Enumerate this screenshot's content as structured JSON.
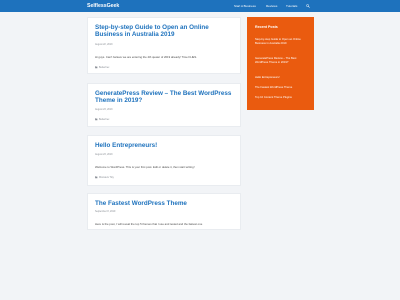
{
  "site": {
    "title": "SelflessGeek"
  },
  "nav": {
    "items": [
      {
        "label": "Start A Business"
      },
      {
        "label": "Reviews"
      },
      {
        "label": "Tutorials"
      }
    ],
    "search_icon": "search-icon"
  },
  "posts": [
    {
      "title": "Step-by-step Guide to Open an Online Business in Australia 2019",
      "date": "August 22, 2019",
      "excerpt": "Hi guys. Can't believe we are entering the 4th quater of 2019 already! Time FLIES.",
      "author": "Bettertrex"
    },
    {
      "title": "GeneratePress Review – The Best WordPress Theme in 2019?",
      "date": "August 23, 2019",
      "excerpt": "",
      "author": "Bettertrex"
    },
    {
      "title": "Hello Entrepreneurs!",
      "date": "August 23, 2019",
      "excerpt": "Welcome to WordPress. This is your first post. Edit or delete it, then start writing!",
      "author": "Monsters Tiny"
    },
    {
      "title": "The Fastest WordPress Theme",
      "date": "September 8, 2019",
      "excerpt": "Here is the post, I will reveal the top 5 themes that I use and tested and the fastest one",
      "author": ""
    }
  ],
  "sidebar": {
    "title": "Recent Posts",
    "links": [
      {
        "label": "Step-by-step Guide to Open an Online Business in Australia 2019"
      },
      {
        "label": "GeneratePress Review – The Best WordPress Theme in 2019?"
      },
      {
        "label": "Hello Entrepreneurs!"
      },
      {
        "label": "The Fastest WordPress Theme"
      },
      {
        "label": "Top 10 Content Theme Plugins"
      }
    ]
  },
  "colors": {
    "header": "#1e72bd",
    "sidebar": "#ea5b0f",
    "link": "#1e72bd",
    "background": "#f2f4f7"
  }
}
